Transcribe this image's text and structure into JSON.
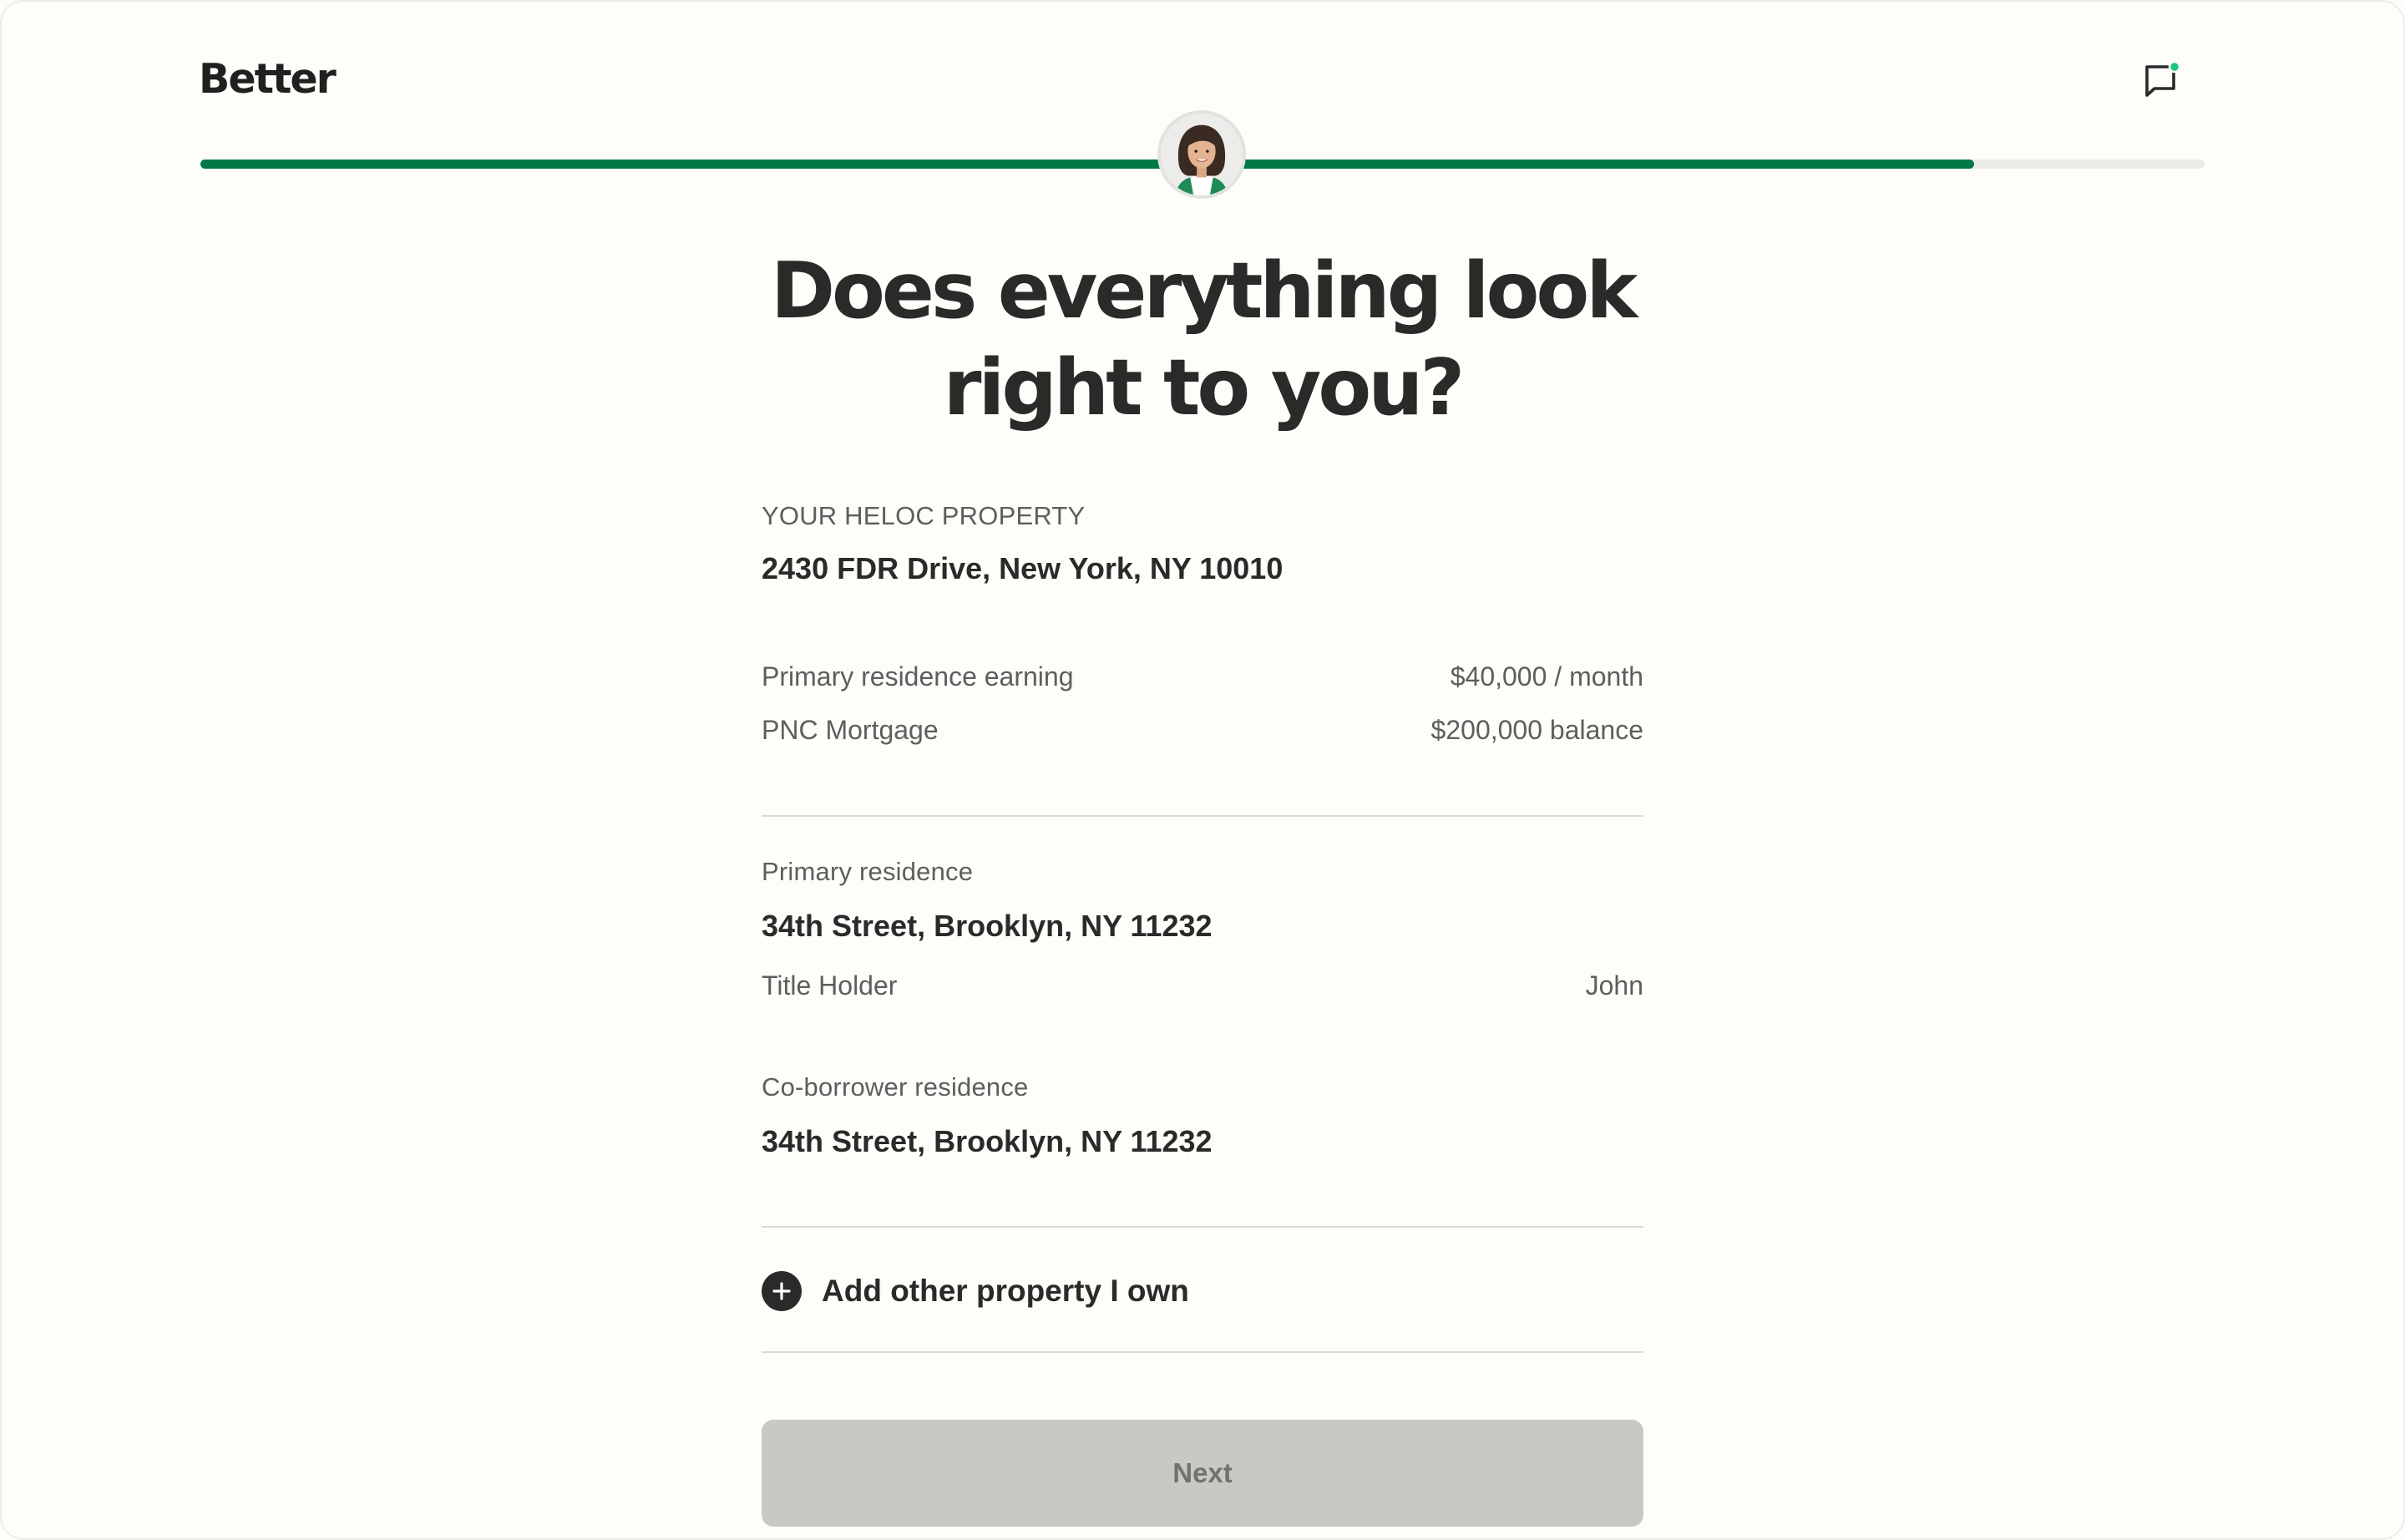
{
  "brand": {
    "logo_text": "Better"
  },
  "header": {
    "chat_icon": "chat-bubble-icon",
    "chat_notification_color": "#1fc77a"
  },
  "progress": {
    "percent": 88.5,
    "fill_color": "#017848",
    "track_color": "#ebebe8"
  },
  "page": {
    "title_line1": "Does everything look",
    "title_line2": "right to you?"
  },
  "heloc_property": {
    "section_label": "YOUR HELOC PROPERTY",
    "address": "2430 FDR Drive, New York, NY 10010",
    "details": [
      {
        "label": "Primary residence earning",
        "value": "$40,000 / month"
      },
      {
        "label": "PNC Mortgage",
        "value": "$200,000 balance"
      }
    ]
  },
  "primary_residence": {
    "section_label": "Primary residence",
    "address": "34th Street, Brooklyn, NY 11232",
    "title_holder_label": "Title Holder",
    "title_holder_value": "John"
  },
  "coborrower_residence": {
    "section_label": "Co-borrower residence",
    "address": "34th Street, Brooklyn, NY 11232"
  },
  "add_property": {
    "label": "Add other property I own",
    "icon": "plus-circle-icon"
  },
  "actions": {
    "next_label": "Next"
  }
}
